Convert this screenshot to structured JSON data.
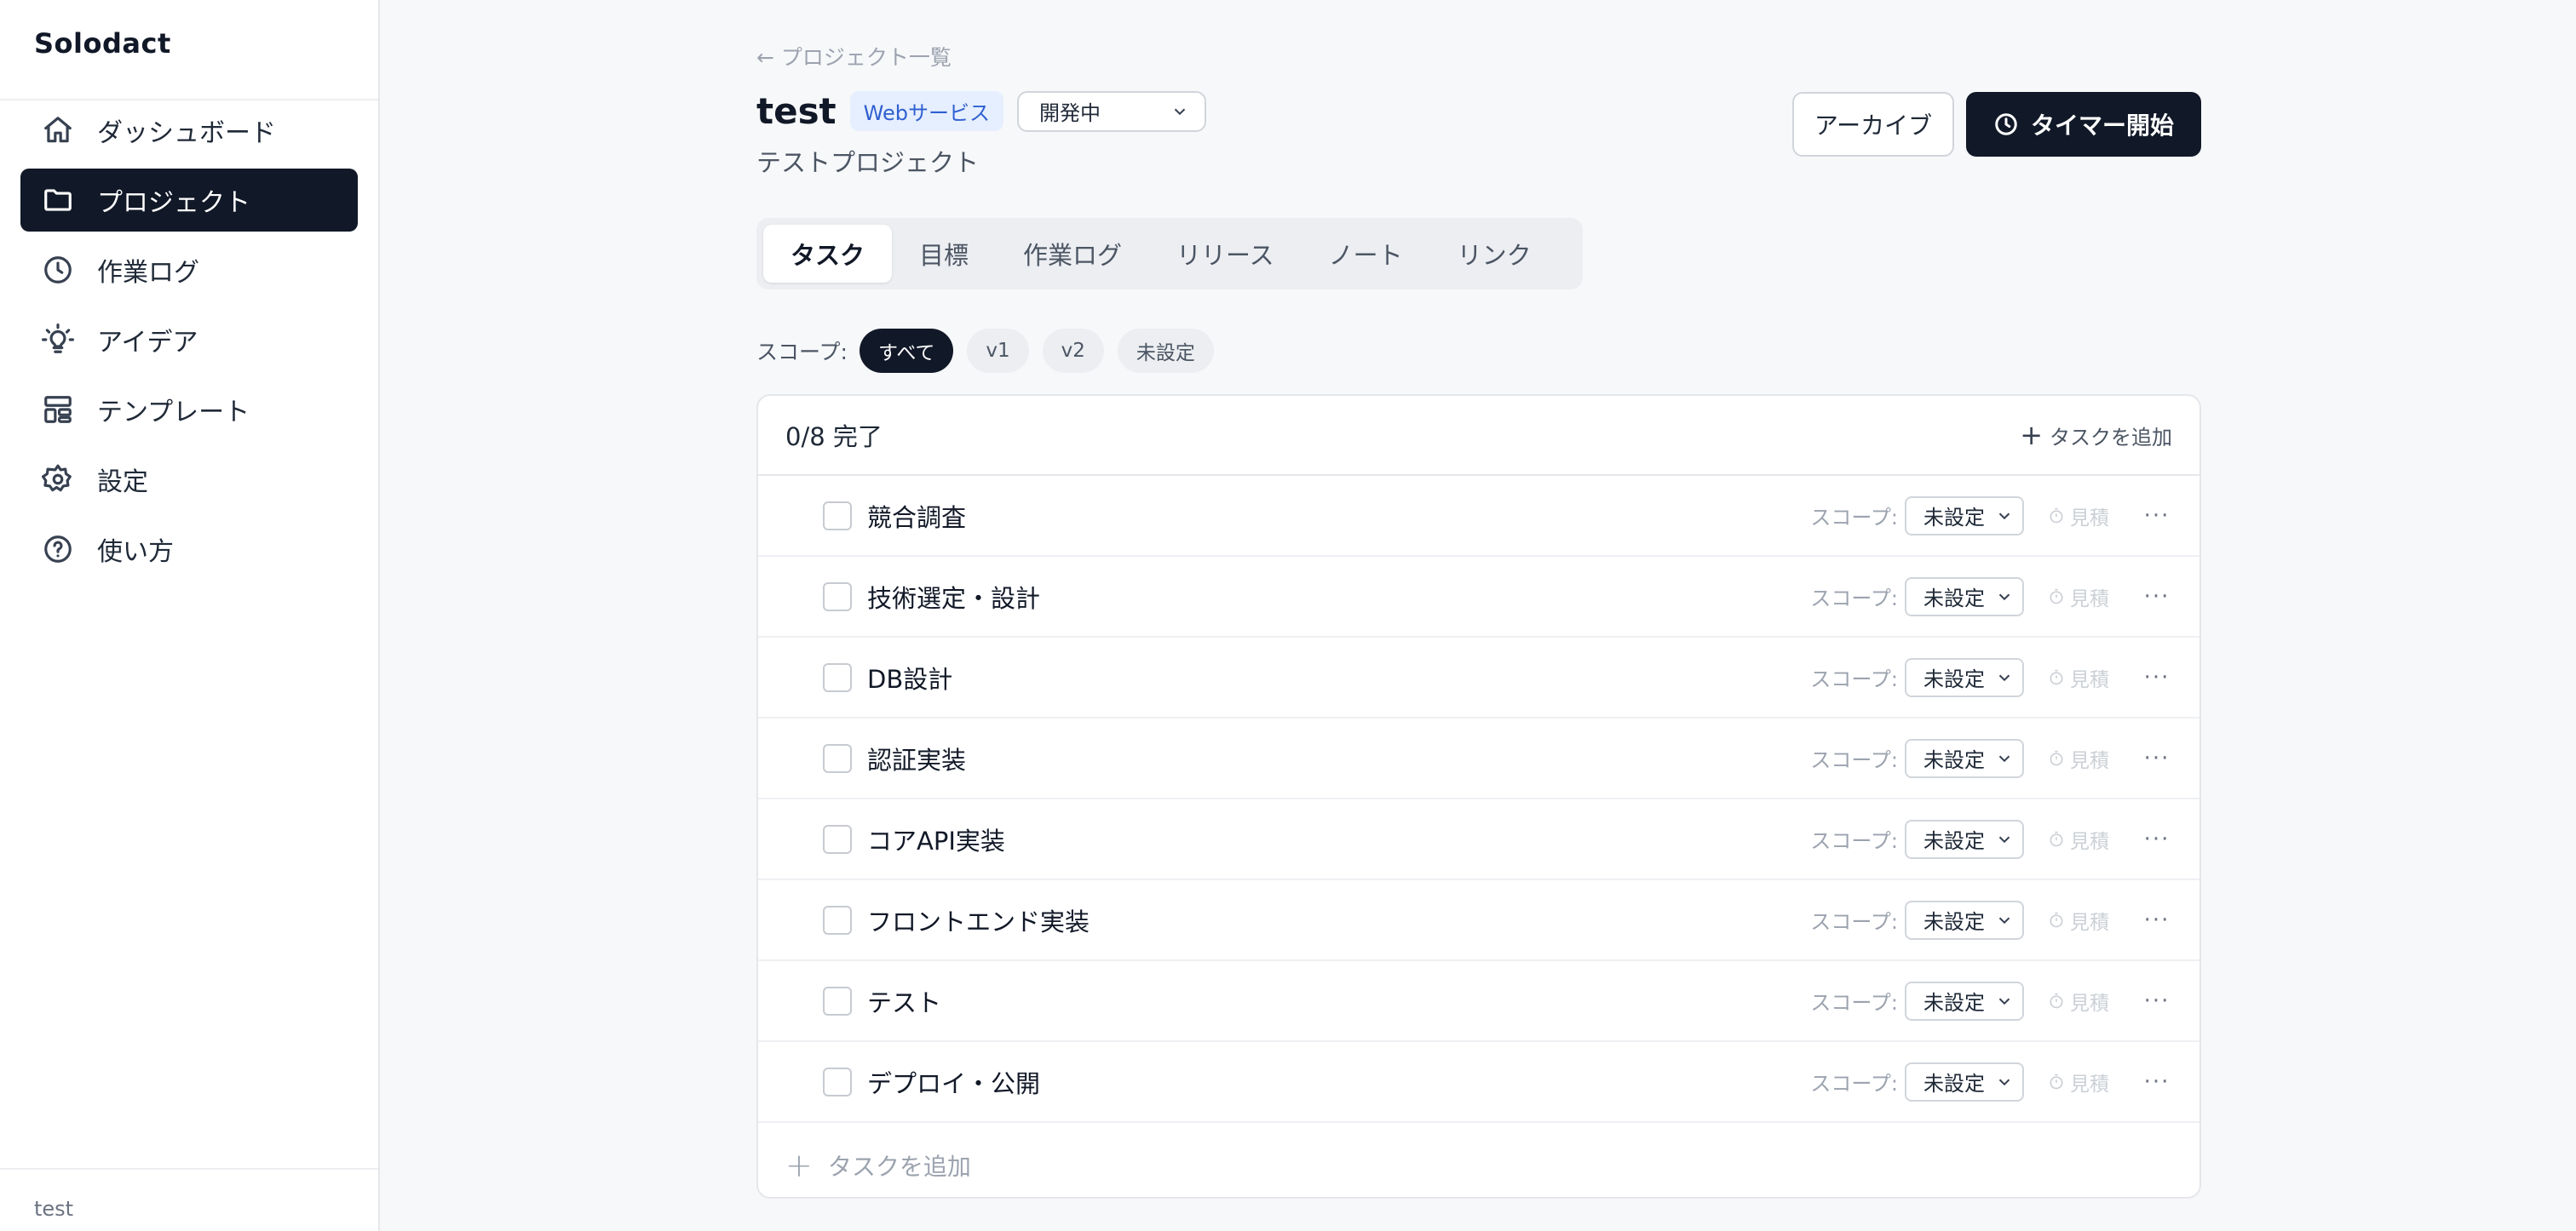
{
  "app": {
    "name": "Solodact",
    "footer_user": "test"
  },
  "sidebar": {
    "items": [
      {
        "label": "ダッシュボード",
        "icon": "home-icon",
        "active": false
      },
      {
        "label": "プロジェクト",
        "icon": "folder-icon",
        "active": true
      },
      {
        "label": "作業ログ",
        "icon": "clock-icon",
        "active": false
      },
      {
        "label": "アイデア",
        "icon": "lightbulb-icon",
        "active": false
      },
      {
        "label": "テンプレート",
        "icon": "template-icon",
        "active": false
      },
      {
        "label": "設定",
        "icon": "gear-icon",
        "active": false
      },
      {
        "label": "使い方",
        "icon": "help-icon",
        "active": false
      }
    ]
  },
  "header": {
    "back_link": "← プロジェクト一覧",
    "title": "test",
    "type_badge": "Webサービス",
    "status": "開発中",
    "subtitle": "テストプロジェクト",
    "archive_label": "アーカイブ",
    "timer_label": "タイマー開始"
  },
  "tabs": [
    "タスク",
    "目標",
    "作業ログ",
    "リリース",
    "ノート",
    "リンク"
  ],
  "scope_filter": {
    "label": "スコープ:",
    "options": [
      "すべて",
      "v1",
      "v2",
      "未設定"
    ],
    "selected": "すべて"
  },
  "tasks_card": {
    "progress": "0/8 完了",
    "add_label": "タスクを追加",
    "bottom_add_label": "タスクを追加",
    "row_scope_label": "スコープ:",
    "row_estimate_label": "見積",
    "row_more": "···",
    "tasks": [
      {
        "name": "競合調査",
        "scope": "未設定",
        "done": false
      },
      {
        "name": "技術選定・設計",
        "scope": "未設定",
        "done": false
      },
      {
        "name": "DB設計",
        "scope": "未設定",
        "done": false
      },
      {
        "name": "認証実装",
        "scope": "未設定",
        "done": false
      },
      {
        "name": "コアAPI実装",
        "scope": "未設定",
        "done": false
      },
      {
        "name": "フロントエンド実装",
        "scope": "未設定",
        "done": false
      },
      {
        "name": "テスト",
        "scope": "未設定",
        "done": false
      },
      {
        "name": "デプロイ・公開",
        "scope": "未設定",
        "done": false
      }
    ]
  },
  "colors": {
    "primary": "#111827",
    "badge_bg": "#e6efff",
    "badge_text": "#2f5fd0",
    "background": "#f7f8fa"
  }
}
